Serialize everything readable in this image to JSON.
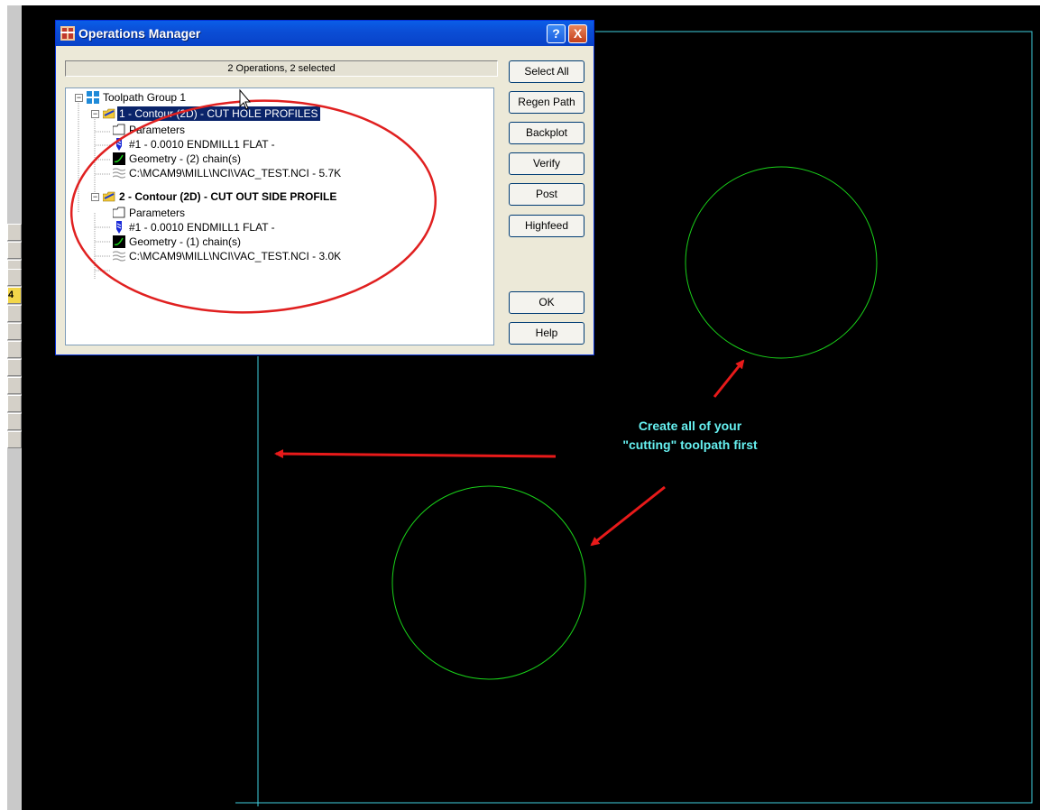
{
  "dialog": {
    "title": "Operations Manager",
    "status": "2 Operations, 2 selected",
    "buttons": {
      "select_all": "Select All",
      "regen_path": "Regen Path",
      "backplot": "Backplot",
      "verify": "Verify",
      "post": "Post",
      "highfeed": "Highfeed",
      "ok": "OK",
      "help": "Help"
    },
    "caption_buttons": {
      "help": "?",
      "close": "X"
    }
  },
  "tree": {
    "group": "Toolpath Group 1",
    "operations": [
      {
        "label": "1 - Contour (2D) - CUT HOLE PROFILES",
        "selected": true,
        "children": [
          "Parameters",
          "#1 - 0.0010 ENDMILL1 FLAT -",
          "Geometry - (2) chain(s)",
          "C:\\MCAM9\\MILL\\NCI\\VAC_TEST.NCI - 5.7K"
        ]
      },
      {
        "label": "2 - Contour (2D) - CUT OUT SIDE PROFILE",
        "selected": false,
        "children": [
          "Parameters",
          "#1 - 0.0010 ENDMILL1 FLAT -",
          "Geometry - (1) chain(s)",
          "C:\\MCAM9\\MILL\\NCI\\VAC_TEST.NCI - 3.0K"
        ]
      }
    ]
  },
  "annotation": {
    "line1": "Create all of your",
    "line2": "\"cutting\" toolpath first"
  },
  "left_toolbar": {
    "highlighted_label": "4"
  },
  "colors": {
    "canvas": "#000000",
    "boundary": "#40d0e0",
    "circle": "#19d219",
    "arrow": "#e81a1a",
    "callout": "#e02020",
    "caption": "#66f0f0"
  }
}
